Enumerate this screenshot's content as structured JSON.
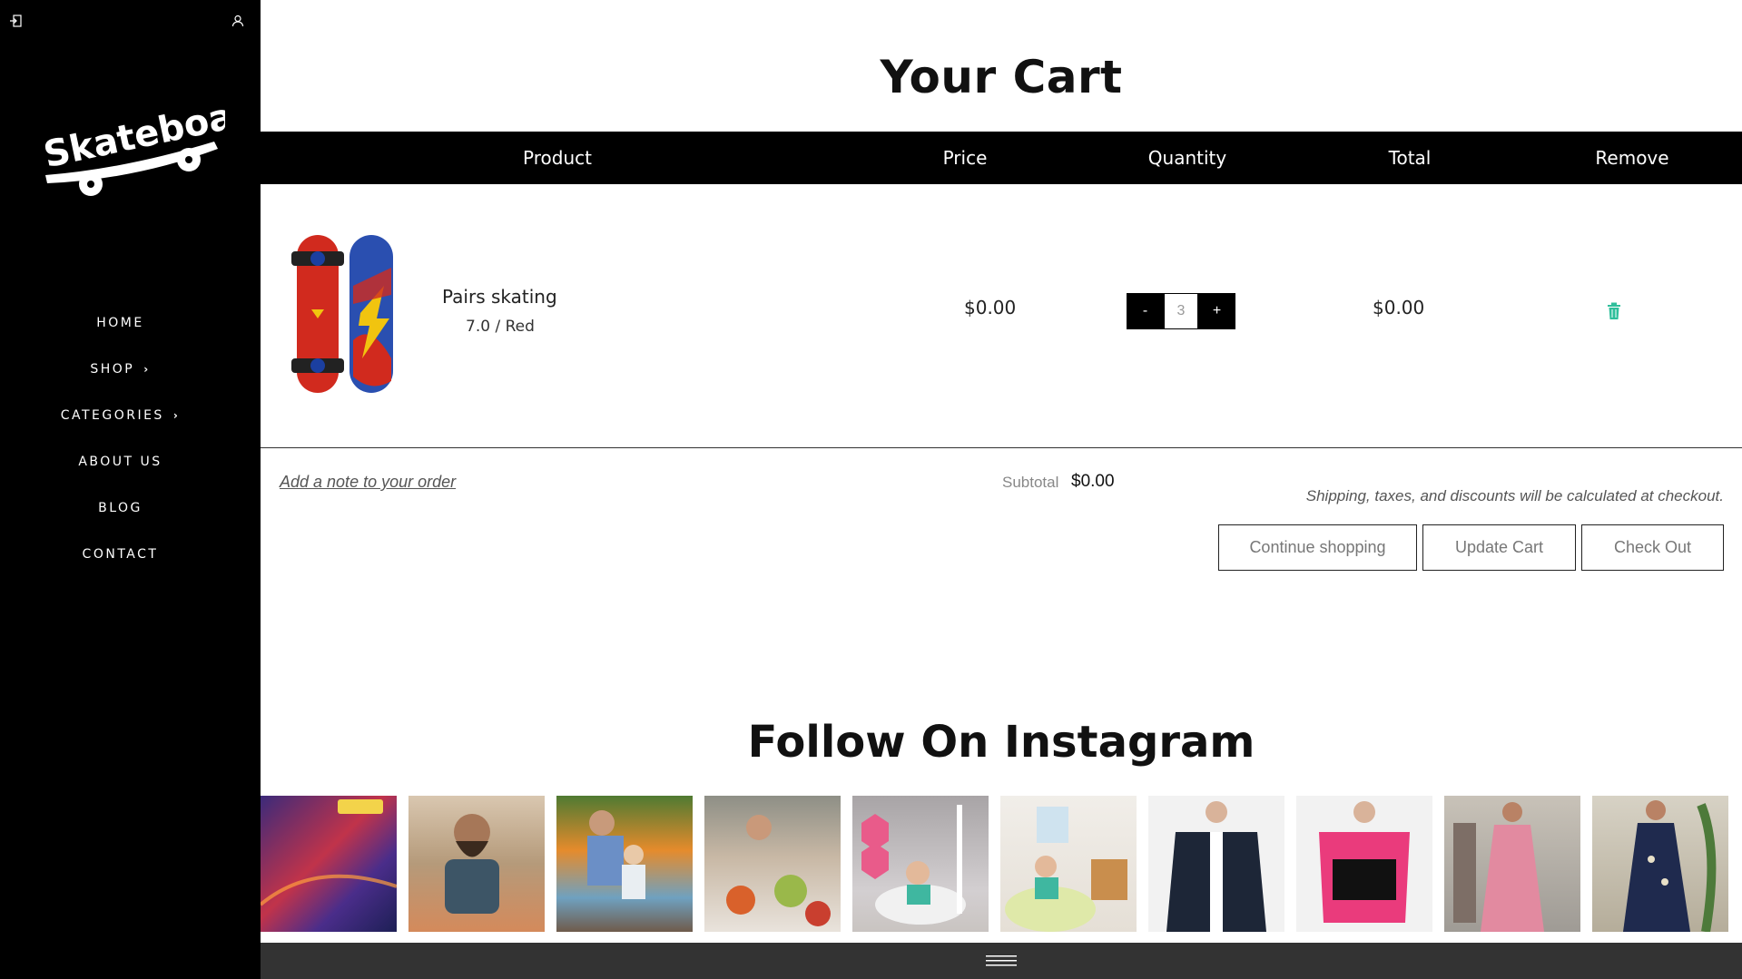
{
  "sidebar": {
    "logo_text": "Skateboard",
    "nav": [
      {
        "label": "HOME",
        "has_submenu": false
      },
      {
        "label": "SHOP",
        "has_submenu": true
      },
      {
        "label": "CATEGORIES",
        "has_submenu": true
      },
      {
        "label": "ABOUT US",
        "has_submenu": false
      },
      {
        "label": "BLOG",
        "has_submenu": false
      },
      {
        "label": "CONTACT",
        "has_submenu": false
      }
    ],
    "icons": [
      "login-icon",
      "user-icon"
    ]
  },
  "cart": {
    "title": "Your Cart",
    "columns": {
      "product": "Product",
      "price": "Price",
      "quantity": "Quantity",
      "total": "Total",
      "remove": "Remove"
    },
    "items": [
      {
        "name": "Pairs skating",
        "variant": "7.0 / Red",
        "price": "$0.00",
        "quantity": "3",
        "minus": "-",
        "plus": "+",
        "total": "$0.00"
      }
    ],
    "note_link": "Add a note to your order",
    "subtotal_label": "Subtotal",
    "subtotal_value": "$0.00",
    "shipping_note": "Shipping, taxes, and discounts will be calculated at checkout.",
    "buttons": {
      "continue": "Continue shopping",
      "update": "Update Cart",
      "checkout": "Check Out"
    }
  },
  "instagram": {
    "title": "Follow On Instagram",
    "tiles": [
      "taxi",
      "bearded-man",
      "father-son-fishing",
      "dinner-party",
      "kid-hexagon-shelves",
      "kid-bean-bag",
      "navy-shirt",
      "pink-tshirt",
      "pink-dress",
      "navy-dress"
    ]
  },
  "colors": {
    "sidebar_bg": "#000000",
    "header_bg": "#000000",
    "accent_trash": "#2fbf9b",
    "bottom_bar": "#333333"
  }
}
